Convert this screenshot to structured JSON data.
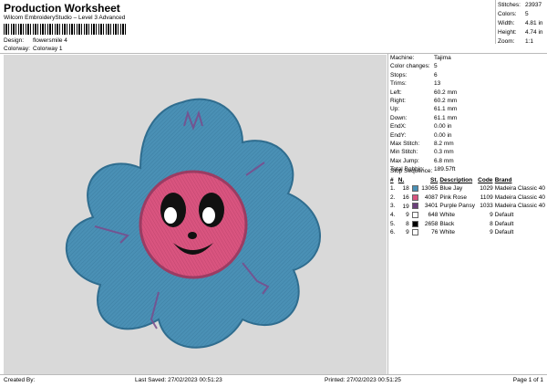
{
  "header": {
    "title": "Production Worksheet",
    "subtitle": "Wilcom EmbroideryStudio – Level 3 Advanced",
    "design_label": "Design:",
    "design_value": "flowersmile 4",
    "colorway_label": "Colorway:",
    "colorway_value": "Colorway 1"
  },
  "summary": [
    {
      "label": "Stitches:",
      "value": "23937"
    },
    {
      "label": "Colors:",
      "value": "5"
    },
    {
      "label": "Width:",
      "value": "4.81 in"
    },
    {
      "label": "Height:",
      "value": "4.74 in"
    },
    {
      "label": "Zoom:",
      "value": "1:1"
    }
  ],
  "machine_info": [
    {
      "label": "Machine:",
      "value": "Tajima"
    },
    {
      "label": "Color changes:",
      "value": "5"
    },
    {
      "label": "Stops:",
      "value": "6"
    },
    {
      "label": "Trims:",
      "value": "13"
    },
    {
      "label": "Left:",
      "value": "60.2 mm"
    },
    {
      "label": "Right:",
      "value": "60.2 mm"
    },
    {
      "label": "Up:",
      "value": "61.1 mm"
    },
    {
      "label": "Down:",
      "value": "61.1 mm"
    },
    {
      "label": "EndX:",
      "value": "0.00 in"
    },
    {
      "label": "EndY:",
      "value": "0.00 in"
    },
    {
      "label": "Max Stitch:",
      "value": "8.2 mm"
    },
    {
      "label": "Min Stitch:",
      "value": "0.3 mm"
    },
    {
      "label": "Max Jump:",
      "value": "6.8 mm"
    },
    {
      "label": "Total Bobbin:",
      "value": "189.57ft"
    }
  ],
  "stop_sequence": {
    "label": "Stop Sequence:",
    "headers": [
      "#",
      "N.",
      "St.",
      "Description",
      "Code",
      "Brand"
    ],
    "rows": [
      {
        "num": "1.",
        "n": "18",
        "color": "#4a90b5",
        "st": "13065",
        "desc": "Blue Jay",
        "code": "1029",
        "brand": "Madeira Classic 40"
      },
      {
        "num": "2.",
        "n": "16",
        "color": "#d9547f",
        "st": "4087",
        "desc": "Pink Rose",
        "code": "1109",
        "brand": "Madeira Classic 40"
      },
      {
        "num": "3.",
        "n": "19",
        "color": "#6b3f7a",
        "st": "3401",
        "desc": "Purple Pansy",
        "code": "1033",
        "brand": "Madeira Classic 40"
      },
      {
        "num": "4.",
        "n": "9",
        "color": "#ffffff",
        "st": "648",
        "desc": "White",
        "code": "9",
        "brand": "Default"
      },
      {
        "num": "5.",
        "n": "8",
        "color": "#000000",
        "st": "2658",
        "desc": "Black",
        "code": "8",
        "brand": "Default"
      },
      {
        "num": "6.",
        "n": "9",
        "color": "#ffffff",
        "st": "76",
        "desc": "White",
        "code": "9",
        "brand": "Default"
      }
    ]
  },
  "footer": {
    "created_by": "Created By:",
    "last_saved": "Last Saved: 27/02/2023 00:51:23",
    "printed": "Printed: 27/02/2023 00:51:25",
    "page": "Page 1 of 1"
  },
  "colors": {
    "petal": "#4a90b5",
    "center": "#d9547f",
    "stitch_accent": "#7a4b8c",
    "background": "#d9d9d9"
  }
}
